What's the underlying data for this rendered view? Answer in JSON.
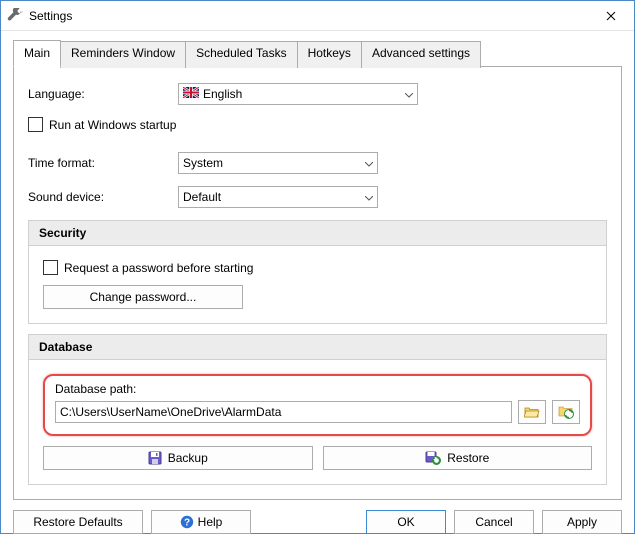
{
  "window": {
    "title": "Settings"
  },
  "tabs": [
    {
      "label": "Main"
    },
    {
      "label": "Reminders Window"
    },
    {
      "label": "Scheduled Tasks"
    },
    {
      "label": "Hotkeys"
    },
    {
      "label": "Advanced settings"
    }
  ],
  "main": {
    "language_label": "Language:",
    "language_value": "English",
    "run_startup_label": "Run at Windows startup",
    "time_format_label": "Time format:",
    "time_format_value": "System",
    "sound_device_label": "Sound device:",
    "sound_device_value": "Default"
  },
  "security": {
    "header": "Security",
    "request_password_label": "Request a password before starting",
    "change_password_label": "Change password..."
  },
  "database": {
    "header": "Database",
    "path_label": "Database path:",
    "path_value": "C:\\Users\\UserName\\OneDrive\\AlarmData",
    "backup_label": "Backup",
    "restore_label": "Restore"
  },
  "footer": {
    "restore_defaults": "Restore Defaults",
    "help": "Help",
    "ok": "OK",
    "cancel": "Cancel",
    "apply": "Apply"
  }
}
